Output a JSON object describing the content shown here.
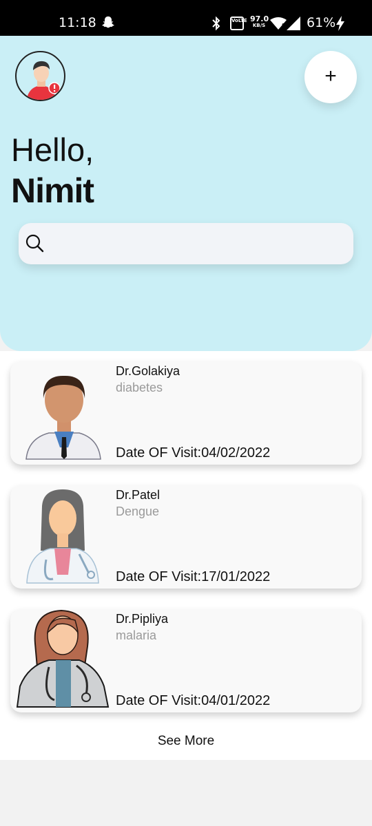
{
  "status_bar": {
    "time": "11:18",
    "volte": "VoLTE",
    "speed_value": "97.0",
    "speed_unit": "KB/S",
    "battery": "61%",
    "icons": [
      "snapchat-icon",
      "bluetooth-icon",
      "volte-icon",
      "wifi-icon",
      "signal-icon",
      "charging-icon"
    ]
  },
  "header": {
    "greeting": "Hello,",
    "username": "Nimit",
    "add_label": "+",
    "search": {
      "placeholder": "",
      "value": ""
    },
    "background_color": "#caeff6"
  },
  "visits": [
    {
      "doctor": "Dr.Golakiya",
      "disease": "diabetes",
      "date_text": "Date OF Visit:04/02/2022"
    },
    {
      "doctor": "Dr.Patel",
      "disease": "Dengue",
      "date_text": "Date OF Visit:17/01/2022"
    },
    {
      "doctor": "Dr.Pipliya",
      "disease": "malaria",
      "date_text": "Date OF Visit:04/01/2022"
    }
  ],
  "see_more_label": "See More"
}
